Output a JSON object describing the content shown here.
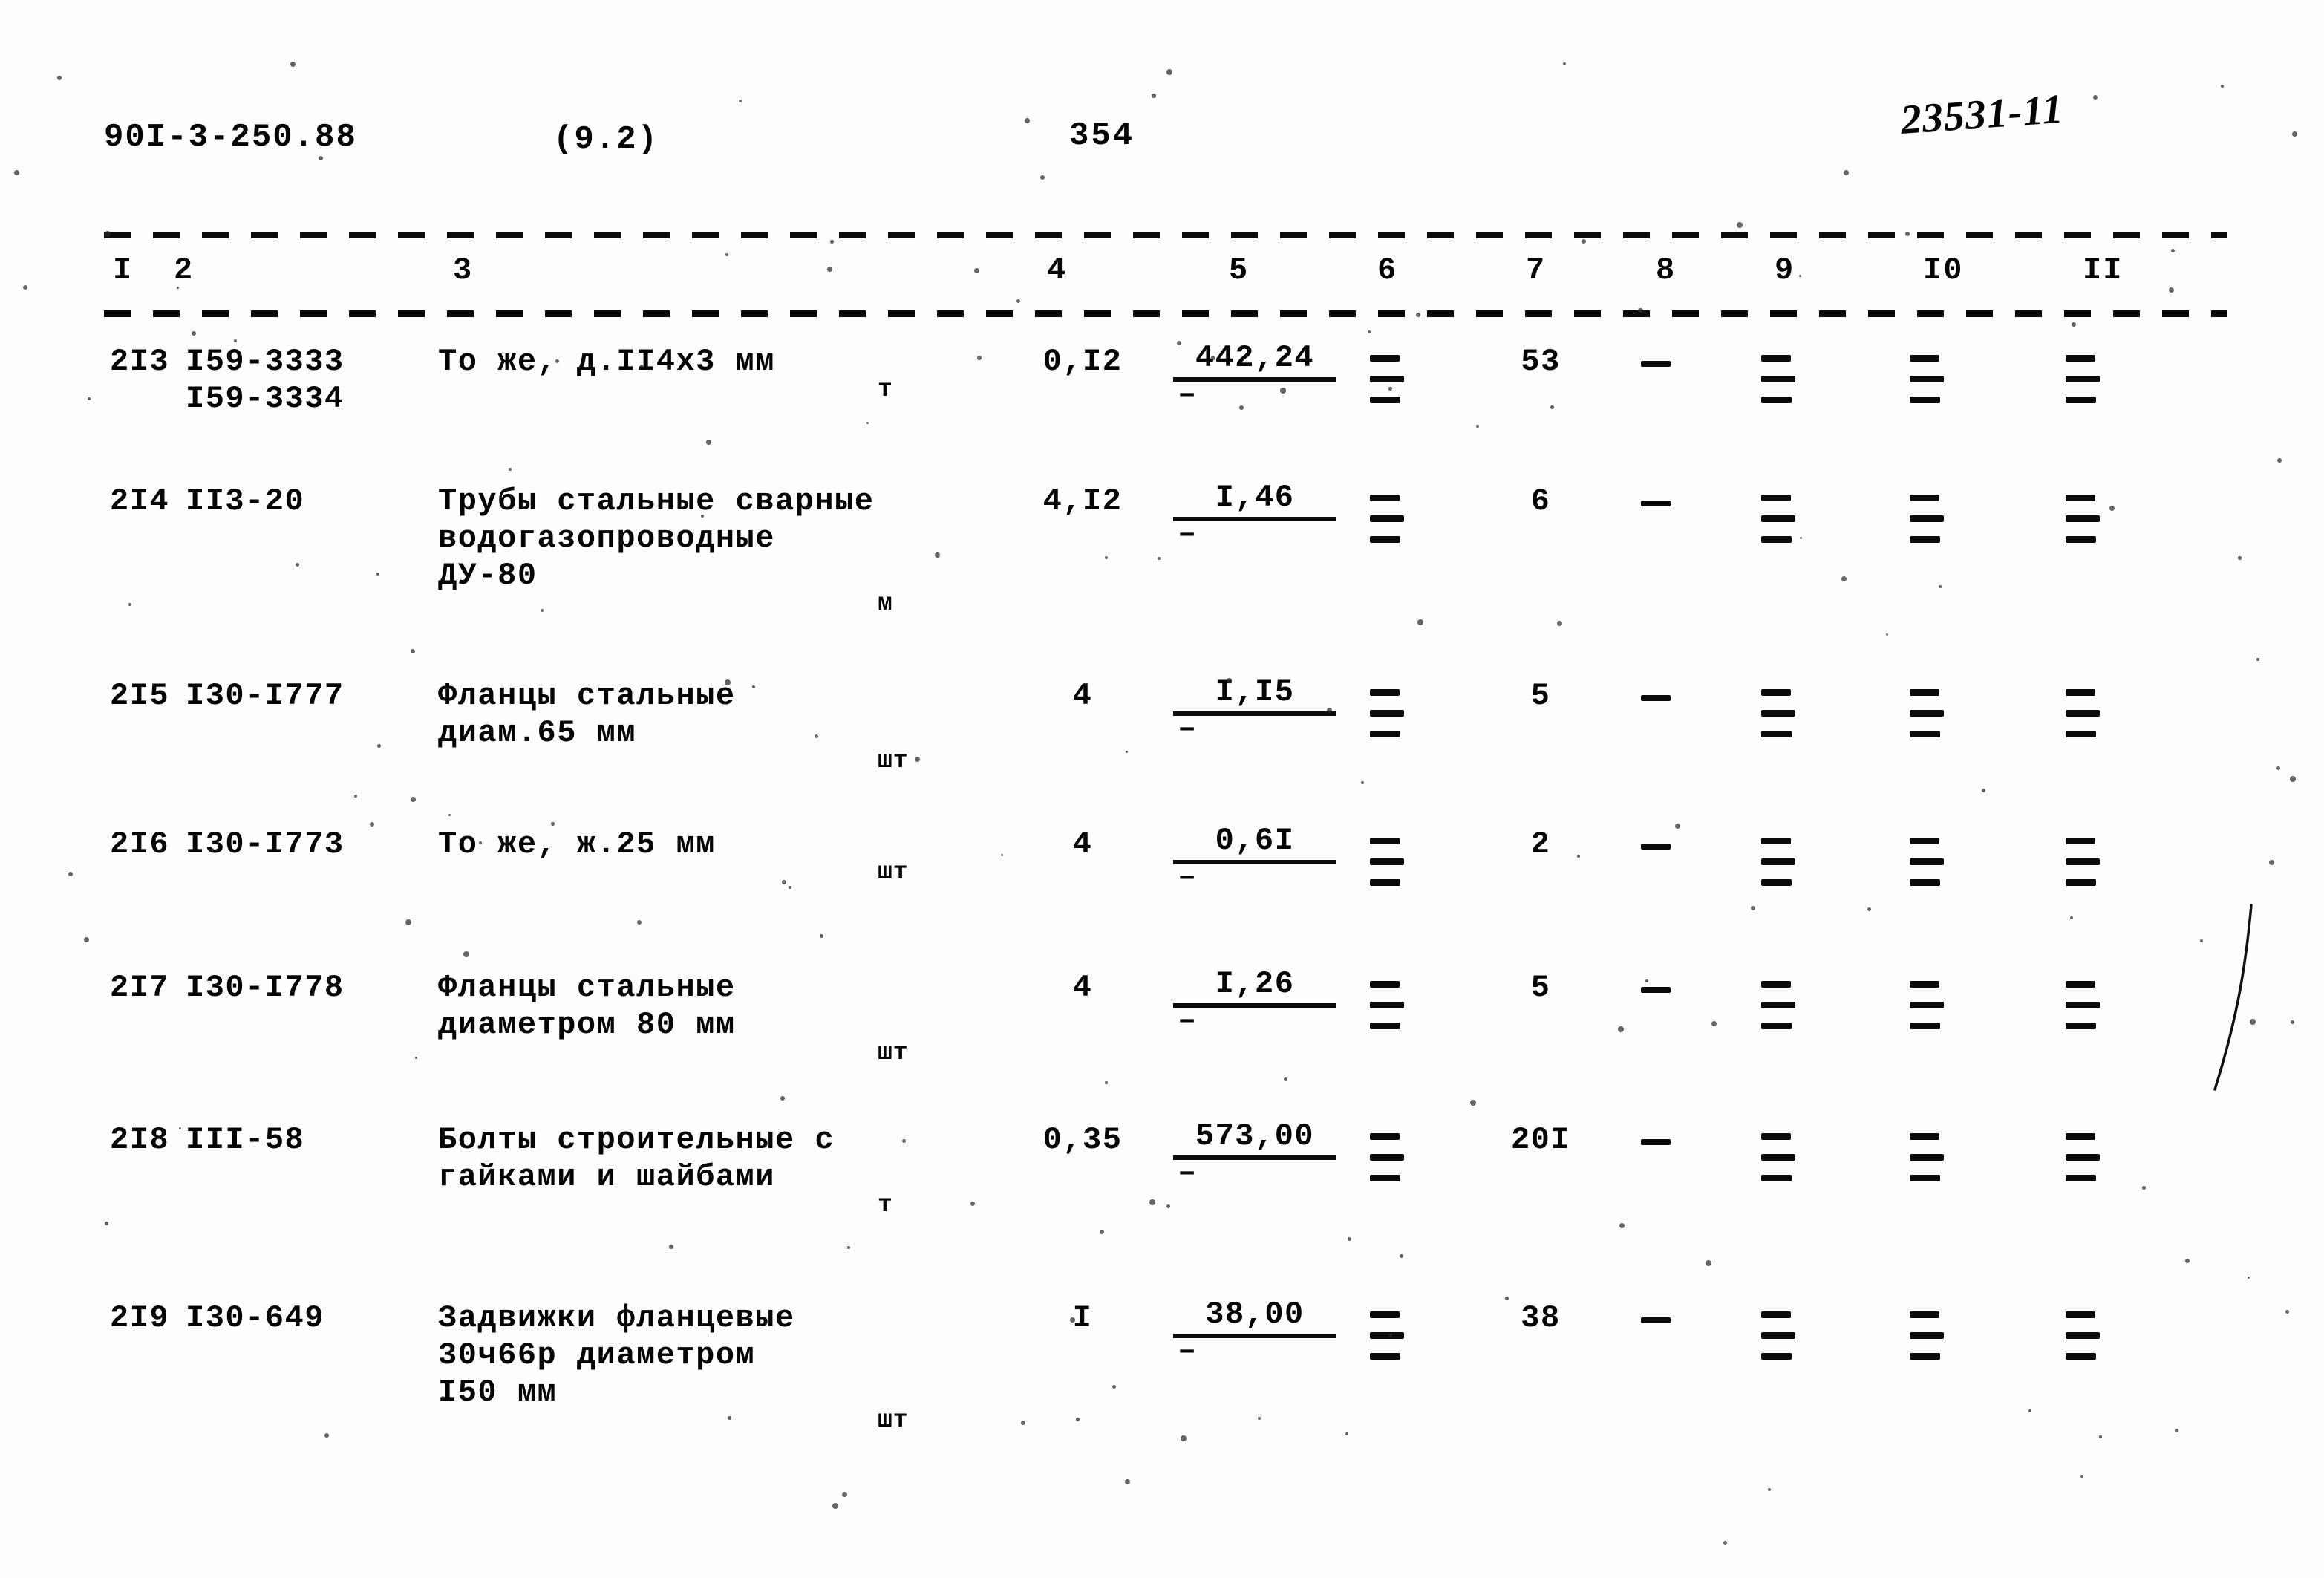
{
  "header": {
    "doc_code": "90I-3-250.88",
    "doc_part": "(9.2)",
    "page_number": "354",
    "handwritten_note": "23531-11"
  },
  "table": {
    "column_headers": [
      "I",
      "2",
      "3",
      "4",
      "5",
      "6",
      "7",
      "8",
      "9",
      "I0",
      "II"
    ],
    "marks": {
      "dash": "–",
      "ditto": "≡"
    },
    "rows": [
      {
        "num": "2I3",
        "codes": [
          "I59-3333",
          "I59-3334"
        ],
        "desc": [
          "То же, д.II4х3 мм"
        ],
        "unit": "т",
        "col4": "0,I2",
        "col5_top": "442,24",
        "col5_bot": "–",
        "col6": "≡",
        "col7": "53",
        "col8": "–",
        "col9": "≡",
        "col10": "≡",
        "col11": "≡"
      },
      {
        "num": "2I4",
        "codes": [
          "II3-20"
        ],
        "desc": [
          "Трубы стальные сварные",
          "водогазопроводные",
          "ДУ-80"
        ],
        "unit": "м",
        "col4": "4,I2",
        "col5_top": "I,46",
        "col5_bot": "–",
        "col6": "≡",
        "col7": "6",
        "col8": "–",
        "col9": "≡",
        "col10": "≡",
        "col11": "≡"
      },
      {
        "num": "2I5",
        "codes": [
          "I30-I777"
        ],
        "desc": [
          "Фланцы стальные",
          "диам.65 мм"
        ],
        "unit": "шт",
        "col4": "4",
        "col5_top": "I,I5",
        "col5_bot": "–",
        "col6": "≡",
        "col7": "5",
        "col8": "–",
        "col9": "≡",
        "col10": "≡",
        "col11": "≡"
      },
      {
        "num": "2I6",
        "codes": [
          "I30-I773"
        ],
        "desc": [
          "То же, ж.25 мм"
        ],
        "unit": "шт",
        "col4": "4",
        "col5_top": "0,6I",
        "col5_bot": "–",
        "col6": "≡",
        "col7": "2",
        "col8": "–",
        "col9": "≡",
        "col10": "≡",
        "col11": "≡"
      },
      {
        "num": "2I7",
        "codes": [
          "I30-I778"
        ],
        "desc": [
          "Фланцы стальные",
          "диаметром 80 мм"
        ],
        "unit": "шт",
        "col4": "4",
        "col5_top": "I,26",
        "col5_bot": "–",
        "col6": "≡",
        "col7": "5",
        "col8": "–",
        "col9": "≡",
        "col10": "≡",
        "col11": "≡"
      },
      {
        "num": "2I8",
        "codes": [
          "III-58"
        ],
        "desc": [
          "Болты строительные с",
          "гайками и шайбами"
        ],
        "unit": "т",
        "col4": "0,35",
        "col5_top": "573,00",
        "col5_bot": "–",
        "col6": "≡",
        "col7": "20I",
        "col8": "–",
        "col9": "≡",
        "col10": "≡",
        "col11": "≡"
      },
      {
        "num": "2I9",
        "codes": [
          "I30-649"
        ],
        "desc": [
          "Задвижки фланцевые",
          "30ч66р диаметром",
          "I50 мм"
        ],
        "unit": "шт",
        "col4": "I",
        "col5_top": "38,00",
        "col5_bot": "–",
        "col6": "≡",
        "col7": "38",
        "col8": "–",
        "col9": "≡",
        "col10": "≡",
        "col11": "≡"
      }
    ]
  }
}
